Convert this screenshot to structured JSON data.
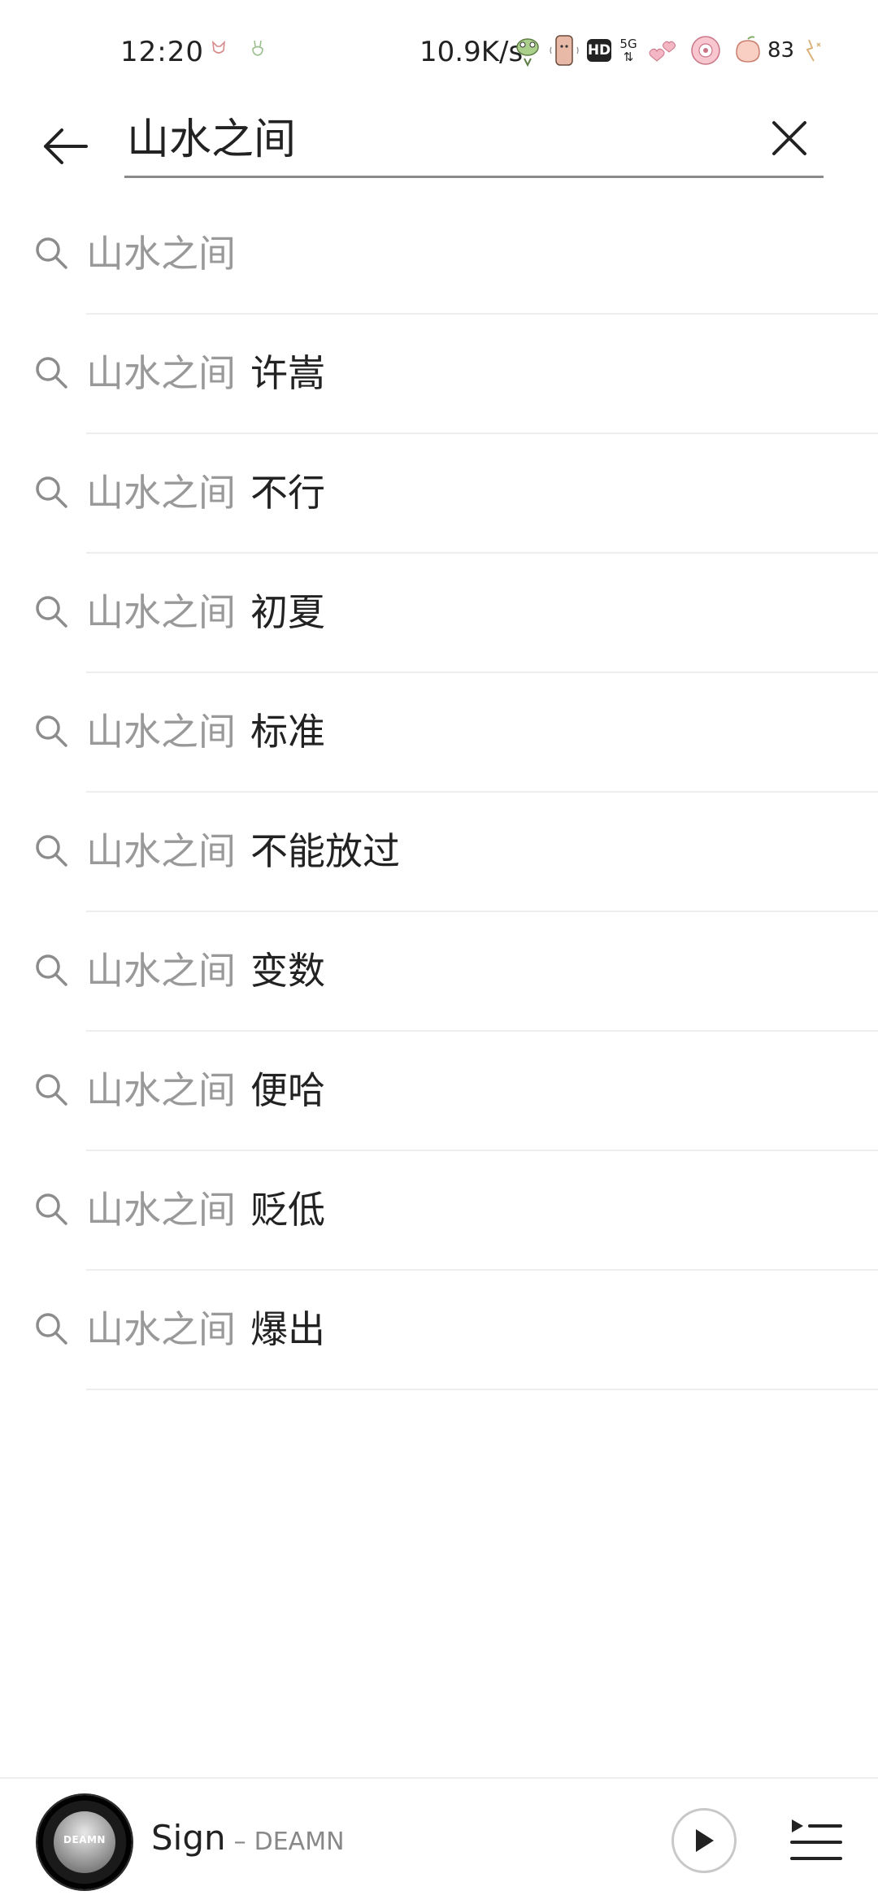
{
  "status_bar": {
    "time": "12:20",
    "network_speed": "10.9K/s",
    "hd_label": "HD",
    "signal_label": "5G",
    "battery_level": "83"
  },
  "search": {
    "query": "山水之间",
    "back_icon": "arrow-left-icon",
    "clear_icon": "close-icon"
  },
  "suggestions": [
    {
      "prefix": "山水之间",
      "suffix": ""
    },
    {
      "prefix": "山水之间",
      "suffix": "许嵩"
    },
    {
      "prefix": "山水之间",
      "suffix": "不行"
    },
    {
      "prefix": "山水之间",
      "suffix": "初夏"
    },
    {
      "prefix": "山水之间",
      "suffix": "标准"
    },
    {
      "prefix": "山水之间",
      "suffix": "不能放过"
    },
    {
      "prefix": "山水之间",
      "suffix": "变数"
    },
    {
      "prefix": "山水之间",
      "suffix": "便哈"
    },
    {
      "prefix": "山水之间",
      "suffix": "贬低"
    },
    {
      "prefix": "山水之间",
      "suffix": "爆出"
    }
  ],
  "player": {
    "song_title": "Sign",
    "separator": "–",
    "artist": "DEAMN",
    "cover_text": "DEAMN",
    "play_icon": "play-icon",
    "playlist_icon": "playlist-icon"
  },
  "colors": {
    "primary_text": "#222222",
    "secondary_text": "#999999",
    "divider": "#eeeeee",
    "search_underline": "#8a8a8a"
  }
}
